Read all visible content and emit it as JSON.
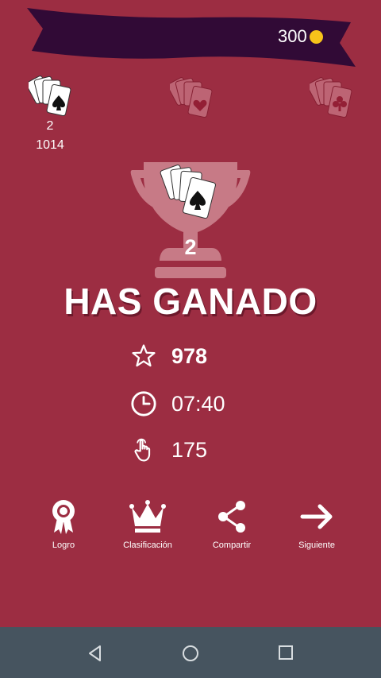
{
  "header": {
    "coins": "300",
    "colors": {
      "banner": "#310a36",
      "coin": "#f7c31a"
    }
  },
  "levels": {
    "active_level": "2",
    "active_score": "1014"
  },
  "trophy": {
    "number": "2"
  },
  "result": {
    "title": "HAS GANADO"
  },
  "stats": {
    "score": "978",
    "time": "07:40",
    "moves": "175"
  },
  "actions": {
    "achievement": "Logro",
    "leaderboard": "Clasificación",
    "share": "Compartir",
    "next": "Siguiente"
  },
  "cards": {
    "spade_ranks": [
      "4",
      "5",
      "6",
      "7"
    ]
  },
  "icons": [
    "star-icon",
    "clock-icon",
    "hand-pointer-icon",
    "ribbon-icon",
    "crown-icon",
    "share-icon",
    "arrow-right-icon",
    "back-icon",
    "home-icon",
    "recents-icon"
  ]
}
